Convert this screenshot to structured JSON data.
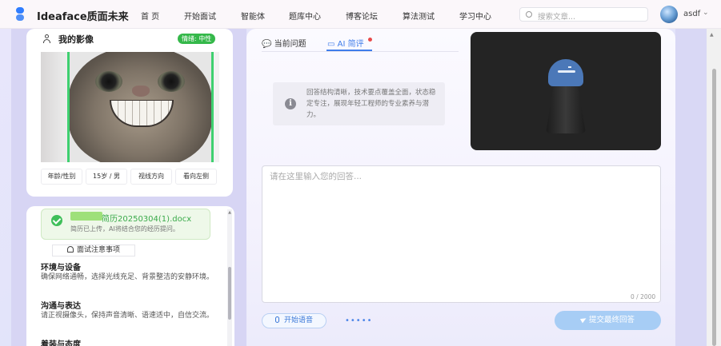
{
  "nav": {
    "brand": "Ideaface质面未来",
    "items": [
      "首 页",
      "开始面试",
      "智能体",
      "题库中心",
      "博客论坛",
      "算法测试",
      "学习中心"
    ],
    "search_placeholder": "搜索文章...",
    "username": "asdf"
  },
  "profile": {
    "title": "我的影像",
    "mood_badge": "情绪: 中性",
    "info": [
      "年龄/性别",
      "15岁 / 男",
      "视线方向",
      "看向左侧"
    ]
  },
  "resume": {
    "file_name": "简历20250304(1).docx",
    "status": "简历已上传，AI将结合您的经历提问。"
  },
  "notice": {
    "title": "面试注意事项",
    "sections": [
      {
        "heading": "环境与设备",
        "body": "确保网络通畅，选择光线充足、背景整洁的安静环境。"
      },
      {
        "heading": "沟通与表达",
        "body": "请正视摄像头，保持声音清晰、语速适中，自信交流。"
      },
      {
        "heading": "着装与态度",
        "body": ""
      }
    ]
  },
  "tabs": {
    "current_question": "当前问题",
    "ai_review": "AI 简评"
  },
  "review": {
    "text": "回答结构清晰，技术要点覆盖全面，状态稳定专注，展现年轻工程师的专业素养与潜力。"
  },
  "answer": {
    "placeholder": "请在这里输入您的回答...",
    "counter": "0 / 2000"
  },
  "actions": {
    "voice": "开始语音",
    "dots": "•••••",
    "submit": "提交最终回答"
  },
  "colors": {
    "accent": "#3f7dea",
    "success": "#35b84a",
    "submit_bg": "#a7cdf5"
  }
}
